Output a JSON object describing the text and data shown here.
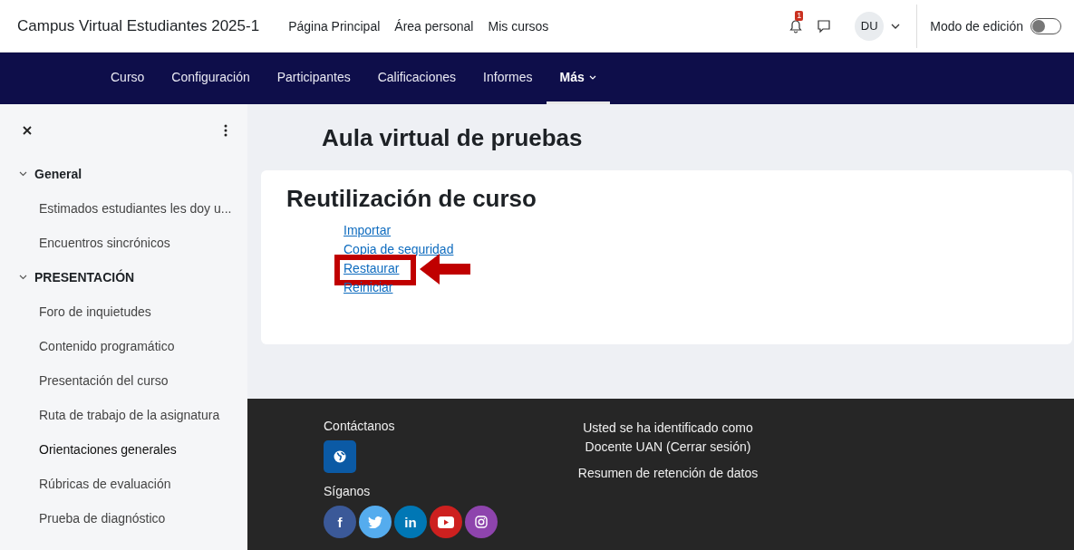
{
  "header": {
    "site_name": "Campus Virtual Estudiantes 2025-1",
    "links": [
      "Página Principal",
      "Área personal",
      "Mis cursos"
    ],
    "notification_count": "1",
    "avatar": "DU",
    "edit_mode": {
      "label": "Modo de edición",
      "on": false
    }
  },
  "course_nav": [
    {
      "label": "Curso",
      "selected": false,
      "dropdown": false
    },
    {
      "label": "Configuración",
      "selected": false,
      "dropdown": false
    },
    {
      "label": "Participantes",
      "selected": false,
      "dropdown": false
    },
    {
      "label": "Calificaciones",
      "selected": false,
      "dropdown": false
    },
    {
      "label": "Informes",
      "selected": false,
      "dropdown": false
    },
    {
      "label": "Más",
      "selected": true,
      "dropdown": true
    }
  ],
  "sidebar": {
    "sections": [
      {
        "title": "General",
        "expanded": true,
        "children": [
          {
            "label": "Estimados estudiantes les doy u...",
            "selected": false
          },
          {
            "label": "Encuentros sincrónicos",
            "selected": false
          }
        ]
      },
      {
        "title": "PRESENTACIÓN",
        "expanded": true,
        "children": [
          {
            "label": "Foro de inquietudes",
            "selected": false
          },
          {
            "label": "Contenido programático",
            "selected": false
          },
          {
            "label": "Presentación del curso",
            "selected": false
          },
          {
            "label": "Ruta de trabajo de la asignatura",
            "selected": false
          },
          {
            "label": "Orientaciones generales",
            "selected": true
          },
          {
            "label": "Rúbricas de evaluación",
            "selected": false
          },
          {
            "label": "Prueba de diagnóstico",
            "selected": false
          }
        ]
      }
    ]
  },
  "course_title": "Aula virtual de pruebas",
  "card": {
    "title": "Reutilización de curso",
    "links": [
      {
        "label": "Importar",
        "highlighted": false
      },
      {
        "label": "Copia de seguridad",
        "highlighted": false
      },
      {
        "label": "Restaurar",
        "highlighted": true
      },
      {
        "label": "Reiniciar",
        "highlighted": false
      }
    ]
  },
  "footer": {
    "contact_heading": "Contáctanos",
    "follow_heading": "Síganos",
    "social": [
      {
        "kind": "facebook",
        "glyph": "f"
      },
      {
        "kind": "twitter"
      },
      {
        "kind": "linkedin",
        "glyph": "in"
      },
      {
        "kind": "youtube"
      },
      {
        "kind": "instagram"
      }
    ],
    "login_lines": [
      "Usted se ha identificado como",
      "Docente UAN (Cerrar sesión)"
    ],
    "data_retention": "Resumen de retención de datos"
  }
}
